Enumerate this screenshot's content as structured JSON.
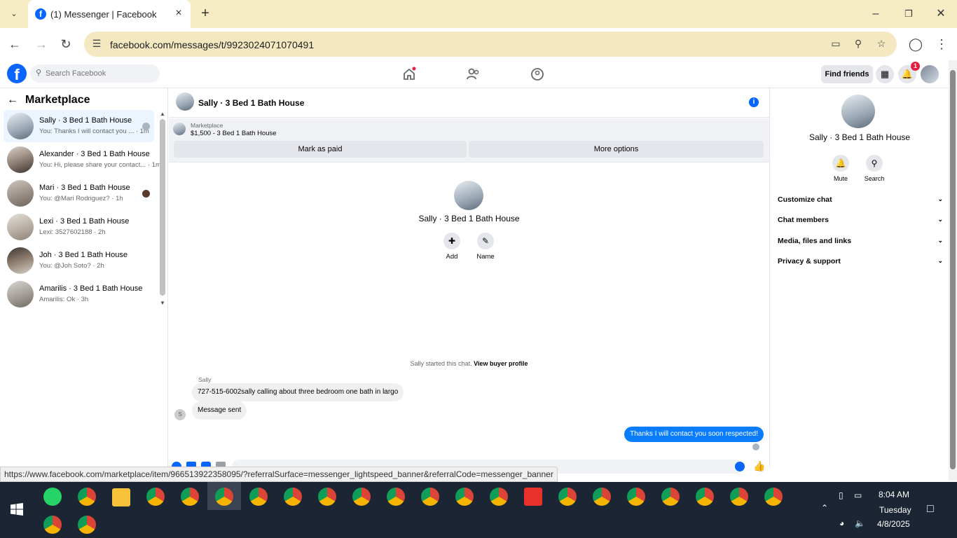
{
  "browser": {
    "tab_title": "(1) Messenger | Facebook",
    "url": "facebook.com/messages/t/9923024071070491",
    "status_url": "https://www.facebook.com/marketplace/item/966513922358095/?referralSurface=messenger_lightspeed_banner&referralCode=messenger_banner"
  },
  "fb": {
    "logo": "f",
    "search_placeholder": "Search Facebook",
    "find_friends": "Find friends",
    "notification_count": "1"
  },
  "left": {
    "title": "Marketplace",
    "conversations": [
      {
        "name": "Sally · 3 Bed 1 Bath House",
        "snippet": "You: Thanks I will contact you ... · 1m"
      },
      {
        "name": "Alexander · 3 Bed 1 Bath House",
        "snippet": "You: Hi, please share your contact... · 1m"
      },
      {
        "name": "Mari · 3 Bed 1 Bath House",
        "snippet": "You: @Mari Rodriguez? · 1h"
      },
      {
        "name": "Lexi · 3 Bed 1 Bath House",
        "snippet": "Lexi: 3527602188 · 2h"
      },
      {
        "name": "Joh · 3 Bed 1 Bath House",
        "snippet": "You: @Joh Soto? · 2h"
      },
      {
        "name": "Amarilis · 3 Bed 1 Bath House",
        "snippet": "Amarilis: Ok · 3h"
      }
    ]
  },
  "chat": {
    "title": "Sally · 3 Bed 1 Bath House",
    "banner_label": "Marketplace",
    "banner_price": "$1,500 - 3 Bed 1 Bath House",
    "mark_paid": "Mark as paid",
    "more_options": "More options",
    "center_name": "Sally · 3 Bed 1 Bath House",
    "add_label": "Add",
    "name_label": "Name",
    "started_text": "Sally started this chat.",
    "view_profile": "View buyer profile",
    "sender": "Sally",
    "msg1": "727-515-6002sally calling about three bedroom one bath in largo",
    "msg2": "Message sent",
    "small_avatar_letter": "S",
    "msg_out": "Thanks I will contact you soon respected!"
  },
  "right": {
    "name": "Sally · 3 Bed 1 Bath House",
    "mute": "Mute",
    "search": "Search",
    "sections": [
      "Customize chat",
      "Chat members",
      "Media, files and links",
      "Privacy & support"
    ]
  },
  "taskbar": {
    "time": "8:04 AM",
    "day": "Tuesday",
    "date": "4/8/2025"
  },
  "colors": {
    "fb_blue": "#0866ff",
    "tab_strip": "#f6ecc4",
    "out_bubble": "#0a7cff"
  }
}
